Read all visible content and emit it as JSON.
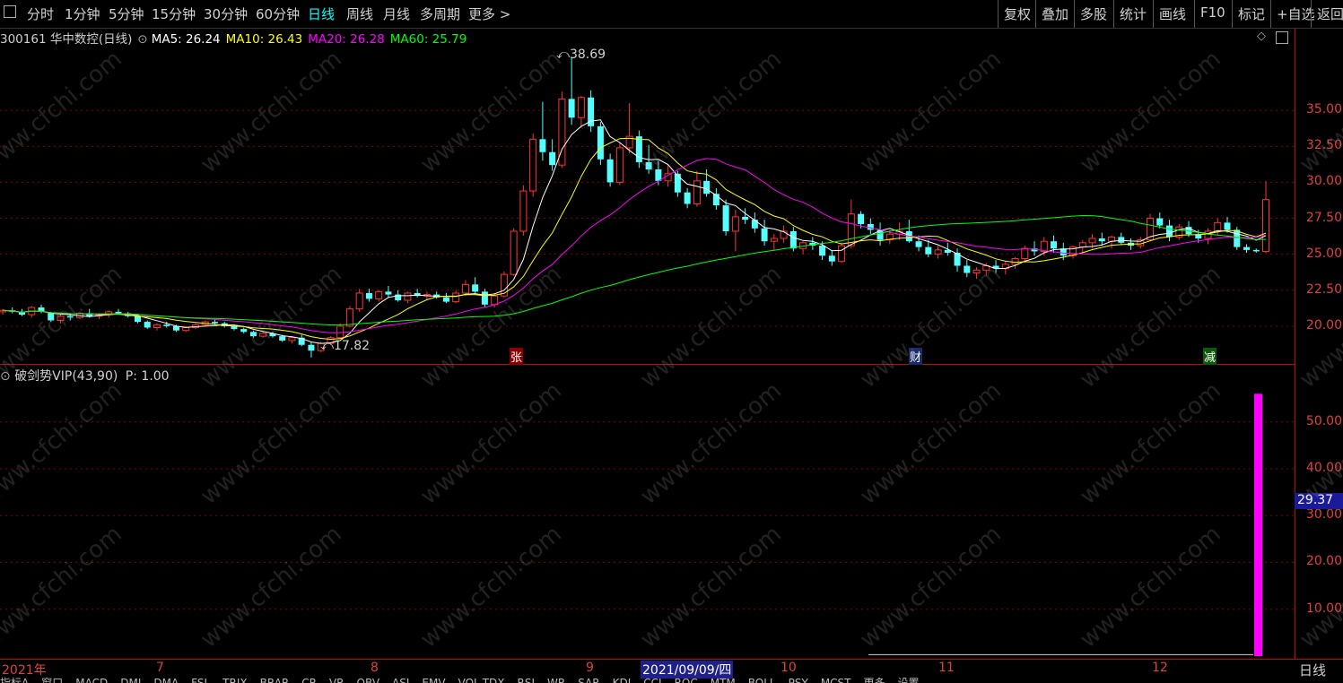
{
  "toolbar": {
    "left_items": [
      "分时",
      "1分钟",
      "5分钟",
      "15分钟",
      "30分钟",
      "60分钟",
      "日线",
      "周线",
      "月线",
      "多周期",
      "更多 >"
    ],
    "active": "日线",
    "right_items": [
      "复权",
      "叠加",
      "多股",
      "统计",
      "画线",
      "F10",
      "标记",
      "+自选",
      "返回"
    ]
  },
  "legend": {
    "title": "300161 华中数控(日线)",
    "ma5": "MA5: 26.24",
    "ma10": "MA10: 26.43",
    "ma20": "MA20: 26.28",
    "ma60": "MA60: 25.79",
    "colors": {
      "ma5": "#ffffff",
      "ma10": "#ffff00",
      "ma20": "#ff00ff",
      "ma60": "#00ff00"
    }
  },
  "indicator": {
    "name": "破剑势VIP(43,90)",
    "p": "P: 1.00",
    "current": "29.37"
  },
  "annotations": {
    "high": "38.69",
    "low": "17.82"
  },
  "markers": [
    "张",
    "财",
    "减"
  ],
  "date_axis": {
    "labels": [
      "2021年",
      "7",
      "8",
      "9",
      "10",
      "11",
      "12"
    ],
    "selected": "2021/09/09/四",
    "period": "日线"
  },
  "bottom_tabs": [
    "指标A",
    "窗口",
    "MACD",
    "DMI",
    "DMA",
    "FSL",
    "TRIX",
    "BRAR",
    "CR",
    "VR",
    "OBV",
    "ASI",
    "EMV",
    "VOL-TDX",
    "RSI",
    "WR",
    "SAR",
    "KDJ",
    "CCI",
    "ROC",
    "MTM",
    "BOLL",
    "PSY",
    "MCST",
    "更多",
    "设置"
  ],
  "watermark": "www.cfchi.com",
  "chart_data": [
    {
      "type": "candlestick",
      "title": "300161 华中数控(日线)",
      "ylim": [
        17.5,
        39.5
      ],
      "yticks": [
        20.0,
        22.5,
        25.0,
        27.5,
        30.0,
        32.5,
        35.0
      ],
      "ytick_labels": [
        "20.00",
        "22.50",
        "25.00",
        "27.50",
        "30.00",
        "32.50",
        "35.00"
      ],
      "candles": [
        [
          21.0,
          21.2,
          20.8,
          21.1
        ],
        [
          21.1,
          21.3,
          20.9,
          21.0
        ],
        [
          21.0,
          21.2,
          20.7,
          20.8
        ],
        [
          20.8,
          21.4,
          20.6,
          21.3
        ],
        [
          21.3,
          21.5,
          20.9,
          21.0
        ],
        [
          20.9,
          21.0,
          20.3,
          20.4
        ],
        [
          20.4,
          20.8,
          20.2,
          20.7
        ],
        [
          20.7,
          20.9,
          20.4,
          20.6
        ],
        [
          20.6,
          21.0,
          20.5,
          20.9
        ],
        [
          20.9,
          21.2,
          20.6,
          20.7
        ],
        [
          20.7,
          20.9,
          20.5,
          20.8
        ],
        [
          20.8,
          21.1,
          20.6,
          21.0
        ],
        [
          21.0,
          21.2,
          20.8,
          20.9
        ],
        [
          20.9,
          21.0,
          20.6,
          20.7
        ],
        [
          20.7,
          20.8,
          20.2,
          20.3
        ],
        [
          20.3,
          20.4,
          19.8,
          19.9
        ],
        [
          19.9,
          20.2,
          19.7,
          20.1
        ],
        [
          20.1,
          20.3,
          19.9,
          20.0
        ],
        [
          20.0,
          20.1,
          19.6,
          19.7
        ],
        [
          19.7,
          20.0,
          19.6,
          19.9
        ],
        [
          19.9,
          20.2,
          19.8,
          20.1
        ],
        [
          20.1,
          20.4,
          20.0,
          20.3
        ],
        [
          20.3,
          20.5,
          20.1,
          20.2
        ],
        [
          20.2,
          20.3,
          19.9,
          20.0
        ],
        [
          20.0,
          20.1,
          19.7,
          19.8
        ],
        [
          19.8,
          19.9,
          19.5,
          19.6
        ],
        [
          19.6,
          19.7,
          19.2,
          19.3
        ],
        [
          19.3,
          19.6,
          19.2,
          19.5
        ],
        [
          19.5,
          19.6,
          19.2,
          19.3
        ],
        [
          19.3,
          19.4,
          18.9,
          19.0
        ],
        [
          19.0,
          19.3,
          18.8,
          19.2
        ],
        [
          19.2,
          19.4,
          18.6,
          18.7
        ],
        [
          18.7,
          18.9,
          17.82,
          18.3
        ],
        [
          18.3,
          18.9,
          18.2,
          18.8
        ],
        [
          18.8,
          19.3,
          18.7,
          19.2
        ],
        [
          19.2,
          20.2,
          19.1,
          20.0
        ],
        [
          20.0,
          21.4,
          19.9,
          21.2
        ],
        [
          21.2,
          22.6,
          21.0,
          22.3
        ],
        [
          22.3,
          22.6,
          21.7,
          21.9
        ],
        [
          21.9,
          22.5,
          21.7,
          22.4
        ],
        [
          22.4,
          22.8,
          22.0,
          22.2
        ],
        [
          22.2,
          22.5,
          21.7,
          21.8
        ],
        [
          21.8,
          22.4,
          21.6,
          22.3
        ],
        [
          22.3,
          22.6,
          22.0,
          22.1
        ],
        [
          22.1,
          22.4,
          21.8,
          22.2
        ],
        [
          22.2,
          22.4,
          21.9,
          22.0
        ],
        [
          22.0,
          22.3,
          21.6,
          21.7
        ],
        [
          21.7,
          22.5,
          21.6,
          22.3
        ],
        [
          22.3,
          23.2,
          22.1,
          22.9
        ],
        [
          22.9,
          23.4,
          22.2,
          22.4
        ],
        [
          22.4,
          22.6,
          21.3,
          21.5
        ],
        [
          21.5,
          22.3,
          21.3,
          22.1
        ],
        [
          22.1,
          23.8,
          22.0,
          23.6
        ],
        [
          23.6,
          26.8,
          23.5,
          26.6
        ],
        [
          26.6,
          29.8,
          26.3,
          29.4
        ],
        [
          29.4,
          33.4,
          29.0,
          33.0
        ],
        [
          33.0,
          35.6,
          31.5,
          32.1
        ],
        [
          32.1,
          33.0,
          30.8,
          31.2
        ],
        [
          31.2,
          36.3,
          31.0,
          35.8
        ],
        [
          35.8,
          38.69,
          34.0,
          34.5
        ],
        [
          34.5,
          36.0,
          33.8,
          35.9
        ],
        [
          35.9,
          36.4,
          33.5,
          33.9
        ],
        [
          33.9,
          34.2,
          31.2,
          31.6
        ],
        [
          31.6,
          32.0,
          29.7,
          30.0
        ],
        [
          30.0,
          32.8,
          29.8,
          32.4
        ],
        [
          32.4,
          35.5,
          32.0,
          33.2
        ],
        [
          33.2,
          33.6,
          31.0,
          31.4
        ],
        [
          31.4,
          32.6,
          30.6,
          30.9
        ],
        [
          30.9,
          31.5,
          29.8,
          30.1
        ],
        [
          30.1,
          31.2,
          29.7,
          30.6
        ],
        [
          30.6,
          30.8,
          29.0,
          29.3
        ],
        [
          29.3,
          29.6,
          28.2,
          28.5
        ],
        [
          28.5,
          30.8,
          28.3,
          30.1
        ],
        [
          30.1,
          30.9,
          29.0,
          29.2
        ],
        [
          29.2,
          29.6,
          28.1,
          28.4
        ],
        [
          28.4,
          28.8,
          26.3,
          26.6
        ],
        [
          26.6,
          28.1,
          25.2,
          27.6
        ],
        [
          27.6,
          28.2,
          27.1,
          27.4
        ],
        [
          27.4,
          27.9,
          26.5,
          26.8
        ],
        [
          26.8,
          27.4,
          25.6,
          25.9
        ],
        [
          25.9,
          26.4,
          25.3,
          26.1
        ],
        [
          26.1,
          27.0,
          25.8,
          26.6
        ],
        [
          26.6,
          26.9,
          25.2,
          25.4
        ],
        [
          25.4,
          25.9,
          25.0,
          25.8
        ],
        [
          25.8,
          26.2,
          25.3,
          25.6
        ],
        [
          25.6,
          25.9,
          24.6,
          24.9
        ],
        [
          24.9,
          25.3,
          24.2,
          24.5
        ],
        [
          24.5,
          25.8,
          24.4,
          25.6
        ],
        [
          25.6,
          28.8,
          25.4,
          27.8
        ],
        [
          27.8,
          28.0,
          26.8,
          27.1
        ],
        [
          27.1,
          27.5,
          26.4,
          26.7
        ],
        [
          26.7,
          27.2,
          25.6,
          26.0
        ],
        [
          26.0,
          26.7,
          25.7,
          26.4
        ],
        [
          26.4,
          27.2,
          26.0,
          26.6
        ],
        [
          26.6,
          27.4,
          25.8,
          25.9
        ],
        [
          25.9,
          26.3,
          25.2,
          25.5
        ],
        [
          25.5,
          26.0,
          24.8,
          25.0
        ],
        [
          25.0,
          25.6,
          24.7,
          25.3
        ],
        [
          25.3,
          25.8,
          24.9,
          25.1
        ],
        [
          25.1,
          25.4,
          23.8,
          24.2
        ],
        [
          24.2,
          24.6,
          23.4,
          23.7
        ],
        [
          23.7,
          24.1,
          23.3,
          23.9
        ],
        [
          23.9,
          24.4,
          23.5,
          24.2
        ],
        [
          24.2,
          24.6,
          23.7,
          24.0
        ],
        [
          24.0,
          24.5,
          23.6,
          24.3
        ],
        [
          24.3,
          24.8,
          24.0,
          24.7
        ],
        [
          24.7,
          25.6,
          24.4,
          25.4
        ],
        [
          25.4,
          25.9,
          24.9,
          25.2
        ],
        [
          25.2,
          26.2,
          24.9,
          25.9
        ],
        [
          25.9,
          26.3,
          25.1,
          25.4
        ],
        [
          25.4,
          25.8,
          24.6,
          24.9
        ],
        [
          24.9,
          25.6,
          24.7,
          25.5
        ],
        [
          25.5,
          26.0,
          25.1,
          25.8
        ],
        [
          25.8,
          26.4,
          25.4,
          26.1
        ],
        [
          26.1,
          26.5,
          25.6,
          25.9
        ],
        [
          25.9,
          26.3,
          25.4,
          26.2
        ],
        [
          26.2,
          26.5,
          25.7,
          25.8
        ],
        [
          25.8,
          26.1,
          25.3,
          25.6
        ],
        [
          25.6,
          26.2,
          25.4,
          26.0
        ],
        [
          26.0,
          27.8,
          25.9,
          27.5
        ],
        [
          27.5,
          27.9,
          26.8,
          27.0
        ],
        [
          27.0,
          27.4,
          25.9,
          26.2
        ],
        [
          26.2,
          27.1,
          26.0,
          26.9
        ],
        [
          26.9,
          27.3,
          26.2,
          26.4
        ],
        [
          26.4,
          26.7,
          25.8,
          26.1
        ],
        [
          26.1,
          26.8,
          25.7,
          26.6
        ],
        [
          26.6,
          27.5,
          26.3,
          27.2
        ],
        [
          27.2,
          27.6,
          26.5,
          26.7
        ],
        [
          26.7,
          26.9,
          25.3,
          25.5
        ],
        [
          25.5,
          25.7,
          25.1,
          25.3
        ],
        [
          25.3,
          25.4,
          25.1,
          25.2
        ],
        [
          25.2,
          30.1,
          25.1,
          28.8
        ]
      ]
    },
    {
      "type": "bar",
      "title": "破剑势VIP(43,90)",
      "ylim": [
        0,
        62
      ],
      "yticks": [
        10,
        20,
        30,
        40,
        50
      ],
      "ytick_labels": [
        "10.00",
        "20.00",
        "30.00",
        "40.00",
        "50.00"
      ],
      "line_value": 0.3,
      "last_bar": 56
    }
  ]
}
